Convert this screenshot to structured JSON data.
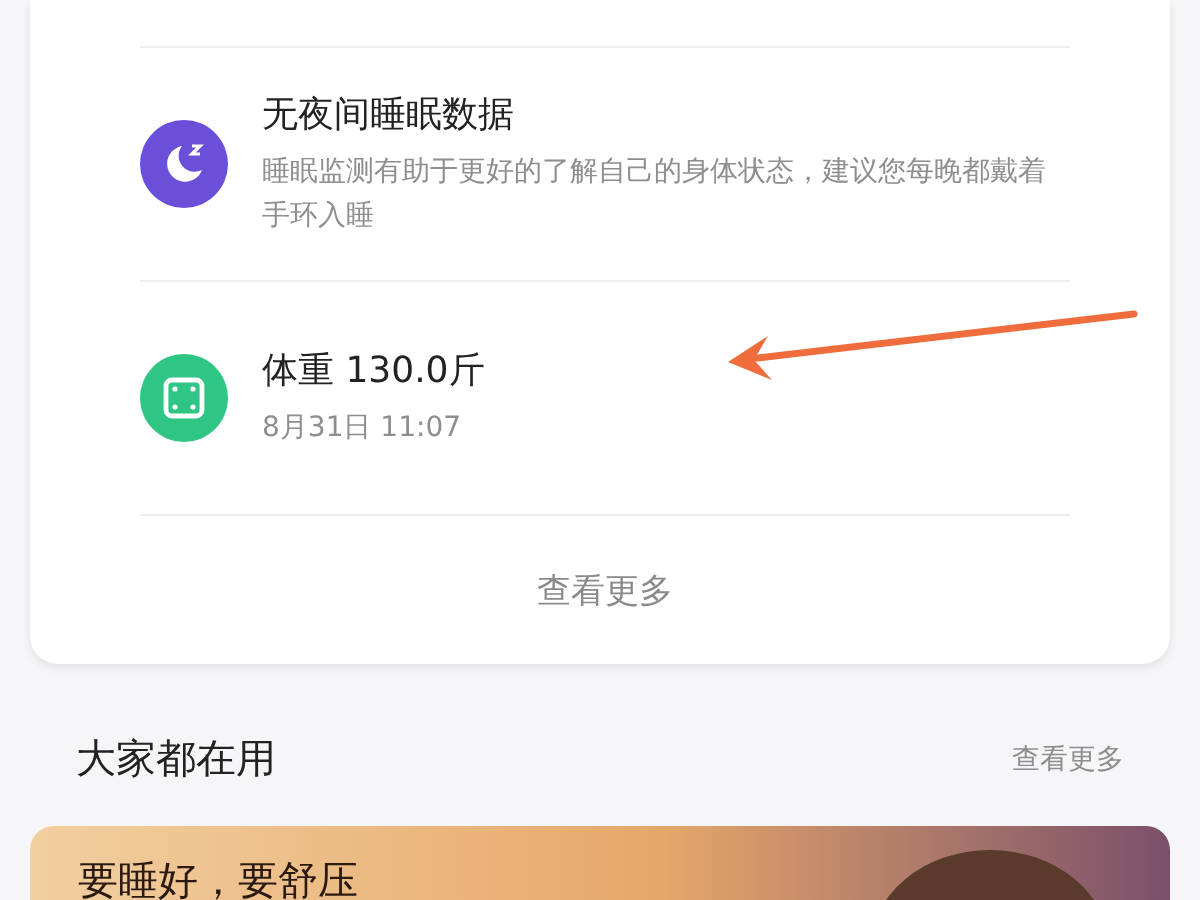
{
  "records": [
    {
      "kind": "sleep",
      "title": "无夜间睡眠数据",
      "detail": "睡眠监测有助于更好的了解自己的身体状态，建议您每晚都戴着手环入睡"
    },
    {
      "kind": "weight",
      "title": "体重 130.0斤",
      "detail": "8月31日 11:07"
    }
  ],
  "records_more": "查看更多",
  "section": {
    "title": "大家都在用",
    "more": "查看更多"
  },
  "banner": {
    "text": "要睡好，要舒压"
  }
}
